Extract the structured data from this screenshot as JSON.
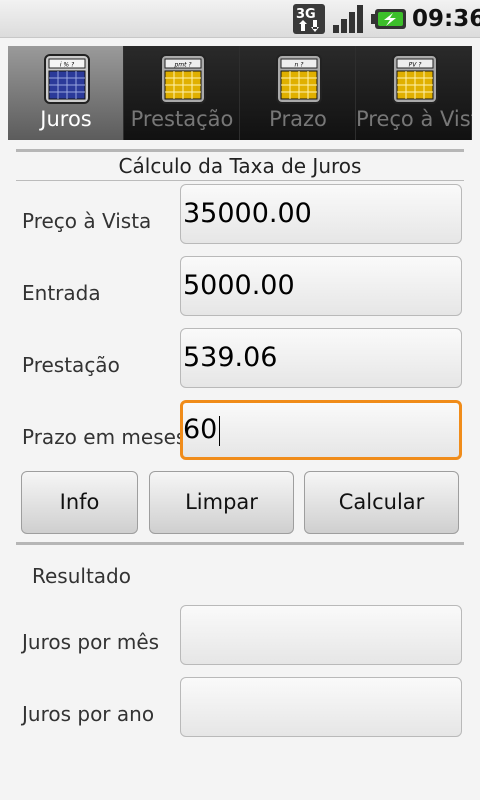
{
  "status_bar": {
    "network": "3G",
    "time": "09:36",
    "icons": [
      "3g-data-icon",
      "signal-strength-icon",
      "battery-charging-icon"
    ]
  },
  "tabs": [
    {
      "label": "Juros",
      "icon_text": "i % ?",
      "active": true
    },
    {
      "label": "Prestação",
      "icon_text": "pmt ?",
      "active": false
    },
    {
      "label": "Prazo",
      "icon_text": "n ?",
      "active": false
    },
    {
      "label": "Preço à Vista",
      "icon_text": "PV ?",
      "active": false
    }
  ],
  "form": {
    "title": "Cálculo da Taxa de Juros",
    "fields": [
      {
        "label": "Preço à Vista",
        "value": "35000.00"
      },
      {
        "label": "Entrada",
        "value": "5000.00"
      },
      {
        "label": "Prestação",
        "value": "539.06"
      },
      {
        "label": "Prazo em meses",
        "value": "60"
      }
    ]
  },
  "buttons": {
    "info": "Info",
    "limpar": "Limpar",
    "calcular": "Calcular"
  },
  "result": {
    "title": "Resultado",
    "fields": [
      {
        "label": "Juros por mês",
        "value": ""
      },
      {
        "label": "Juros por ano",
        "value": ""
      }
    ]
  },
  "colors": {
    "focus_border": "#f08c1a",
    "active_tab_icon": "#2b3a9a",
    "inactive_tab_icon": "#e0b000"
  }
}
